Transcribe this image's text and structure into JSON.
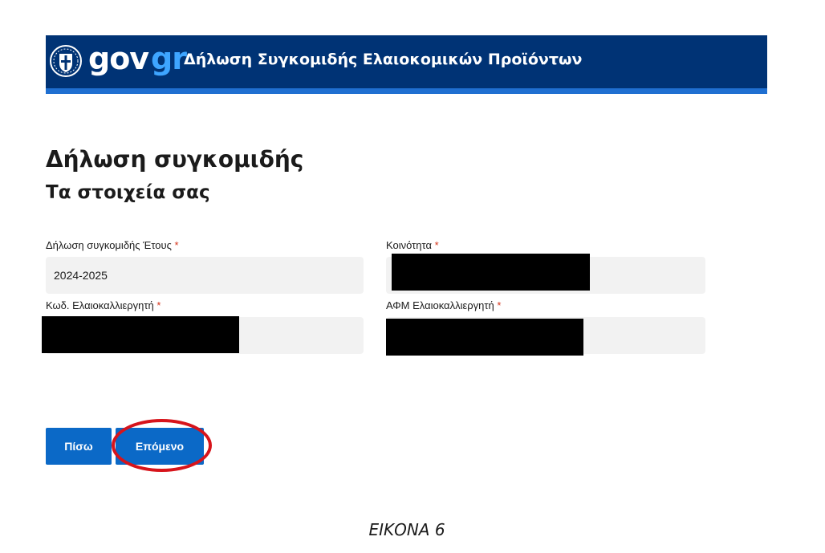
{
  "header": {
    "logo_gov": "gov",
    "logo_gr": "gr",
    "service_title": "Δήλωση Συγκομιδής Ελαιοκομικών Προϊόντων",
    "colors": {
      "bar": "#003375",
      "stripe": "#1f6fd1",
      "logo_accent": "#3ea5ff"
    }
  },
  "main": {
    "title": "Δήλωση συγκομιδής",
    "subtitle": "Τα στοιχεία σας"
  },
  "form": {
    "year": {
      "label": "Δήλωση συγκομιδής Έτους",
      "required_mark": "*",
      "value": "2024-2025"
    },
    "community": {
      "label": "Κοινότητα",
      "required_mark": "*",
      "value": ""
    },
    "grower_code": {
      "label": "Κωδ. Ελαιοκαλλιεργητή",
      "required_mark": "*",
      "value": ""
    },
    "tax_id": {
      "label": "ΑΦΜ Ελαιοκαλλιεργητή",
      "required_mark": "*",
      "value": ""
    }
  },
  "buttons": {
    "back": "Πίσω",
    "next": "Επόμενο",
    "color": "#0b69c7",
    "highlight_color": "#d7141b"
  },
  "caption": "ΕΙΚΟΝΑ 6"
}
